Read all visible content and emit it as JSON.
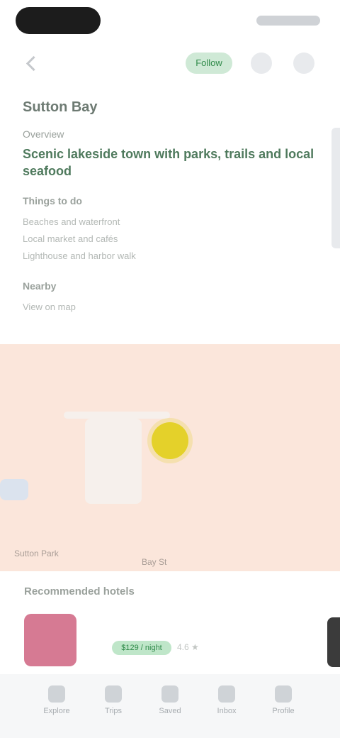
{
  "header": {
    "follow_label": "Follow"
  },
  "place": {
    "name": "Sutton Bay",
    "subtitle": "Overview",
    "highlight": "Scenic lakeside town with parks, trails and local seafood",
    "section1_title": "Things to do",
    "lines": [
      "Beaches and waterfront",
      "Local market and cafés",
      "Lighthouse and harbor walk"
    ],
    "section2_title": "Nearby",
    "section2_line": "View on map"
  },
  "map": {
    "label_left": "Sutton Park",
    "label_center": "Bay St"
  },
  "bottom_card": {
    "title": "Recommended hotels",
    "price_tag": "$129 / night",
    "price_sub": "4.6 ★"
  },
  "nav": {
    "items": [
      {
        "label": "Explore"
      },
      {
        "label": "Trips"
      },
      {
        "label": "Saved"
      },
      {
        "label": "Inbox"
      },
      {
        "label": "Profile"
      }
    ]
  },
  "colors": {
    "accent": "#2f8a49",
    "map_bg": "#fbe6db",
    "marker": "#e4d12a"
  }
}
